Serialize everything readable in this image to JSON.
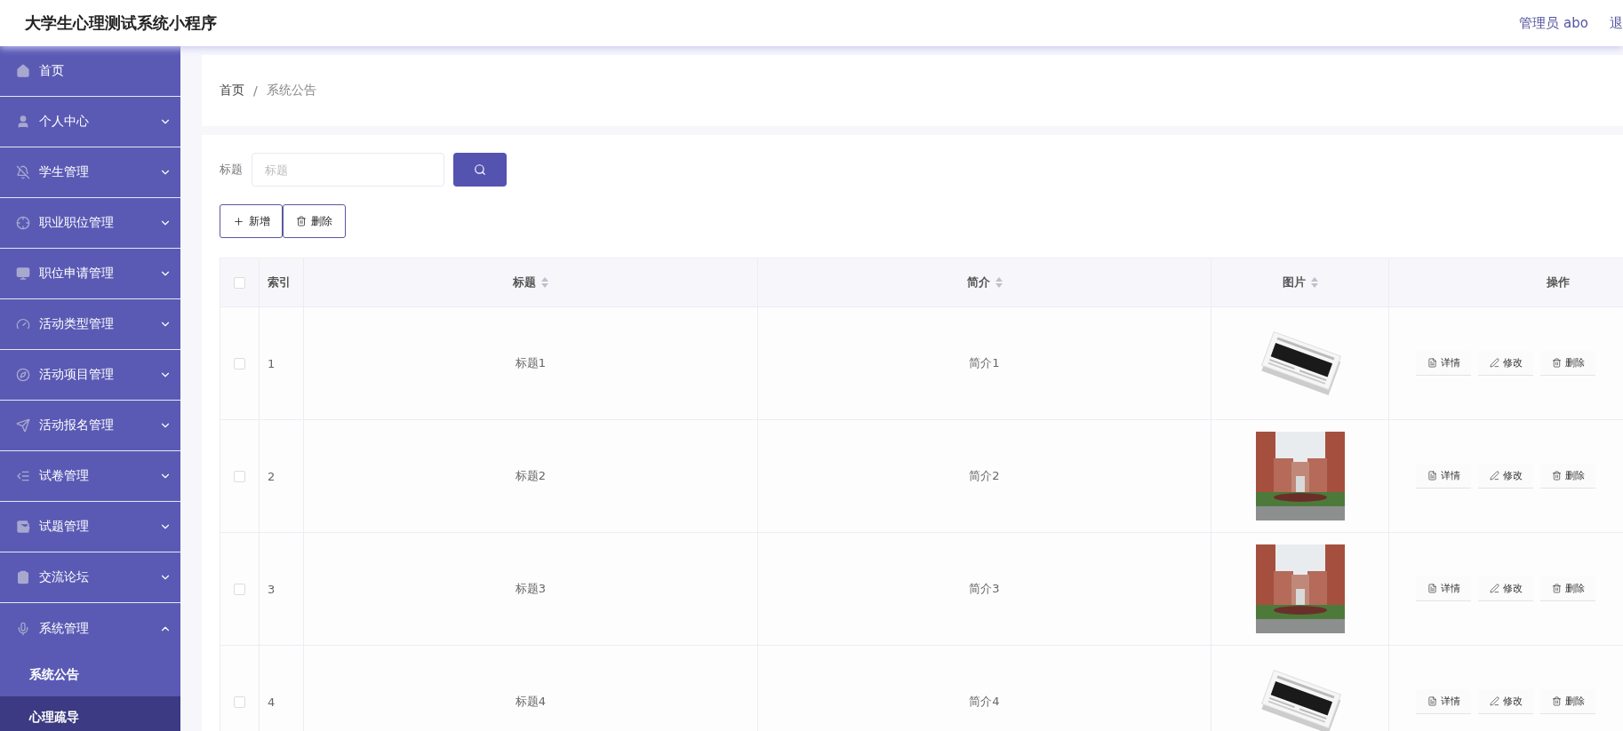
{
  "header": {
    "title": "大学生心理测试系统小程序",
    "user": "管理员 abo",
    "logout": "退"
  },
  "sidebar": {
    "items": [
      {
        "label": "首页",
        "kind": "link"
      },
      {
        "label": "个人中心",
        "kind": "submenu",
        "expanded": false
      },
      {
        "label": "学生管理",
        "kind": "submenu",
        "expanded": false
      },
      {
        "label": "职业职位管理",
        "kind": "submenu",
        "expanded": false
      },
      {
        "label": "职位申请管理",
        "kind": "submenu",
        "expanded": false
      },
      {
        "label": "活动类型管理",
        "kind": "submenu",
        "expanded": false
      },
      {
        "label": "活动项目管理",
        "kind": "submenu",
        "expanded": false
      },
      {
        "label": "活动报名管理",
        "kind": "submenu",
        "expanded": false
      },
      {
        "label": "试卷管理",
        "kind": "submenu",
        "expanded": false
      },
      {
        "label": "试题管理",
        "kind": "submenu",
        "expanded": false
      },
      {
        "label": "交流论坛",
        "kind": "submenu",
        "expanded": false
      },
      {
        "label": "系统管理",
        "kind": "submenu",
        "expanded": true,
        "children": [
          {
            "label": "系统公告",
            "selected": false
          },
          {
            "label": "心理疏导",
            "selected": true
          }
        ]
      }
    ]
  },
  "breadcrumb": {
    "items": [
      "首页",
      "系统公告"
    ],
    "separator": "/"
  },
  "search": {
    "label": "标题",
    "placeholder": "标题"
  },
  "toolbar": [
    {
      "label": "新增",
      "kind": "add"
    },
    {
      "label": "删除",
      "kind": "delete"
    }
  ],
  "table": {
    "select_all": {
      "checked": false
    },
    "columns": [
      {
        "label": "索引",
        "sortable": false
      },
      {
        "label": "标题",
        "sortable": true
      },
      {
        "label": "简介",
        "sortable": true
      },
      {
        "label": "图片",
        "sortable": true
      },
      {
        "label": "操作",
        "sortable": false
      }
    ],
    "rows": [
      {
        "checked": false,
        "index": "1",
        "title": "标题1",
        "intro": "简介1",
        "image": {
          "kind": "picture"
        },
        "actions": [
          {
            "label": "详情",
            "kind": "detail"
          },
          {
            "label": "修改",
            "kind": "edit"
          },
          {
            "label": "删除",
            "kind": "delete"
          }
        ]
      },
      {
        "checked": false,
        "index": "2",
        "title": "标题2",
        "intro": "简介2",
        "image": {
          "kind": "picture"
        },
        "actions": [
          {
            "label": "详情",
            "kind": "detail"
          },
          {
            "label": "修改",
            "kind": "edit"
          },
          {
            "label": "删除",
            "kind": "delete"
          }
        ]
      },
      {
        "checked": false,
        "index": "3",
        "title": "标题3",
        "intro": "简介3",
        "image": {
          "kind": "picture"
        },
        "actions": [
          {
            "label": "详情",
            "kind": "detail"
          },
          {
            "label": "修改",
            "kind": "edit"
          },
          {
            "label": "删除",
            "kind": "delete"
          }
        ]
      },
      {
        "checked": false,
        "index": "4",
        "title": "标题4",
        "intro": "简介4",
        "image": {
          "kind": "picture"
        },
        "actions": [
          {
            "label": "详情",
            "kind": "detail"
          },
          {
            "label": "修改",
            "kind": "edit"
          },
          {
            "label": "删除",
            "kind": "delete"
          }
        ]
      }
    ]
  }
}
